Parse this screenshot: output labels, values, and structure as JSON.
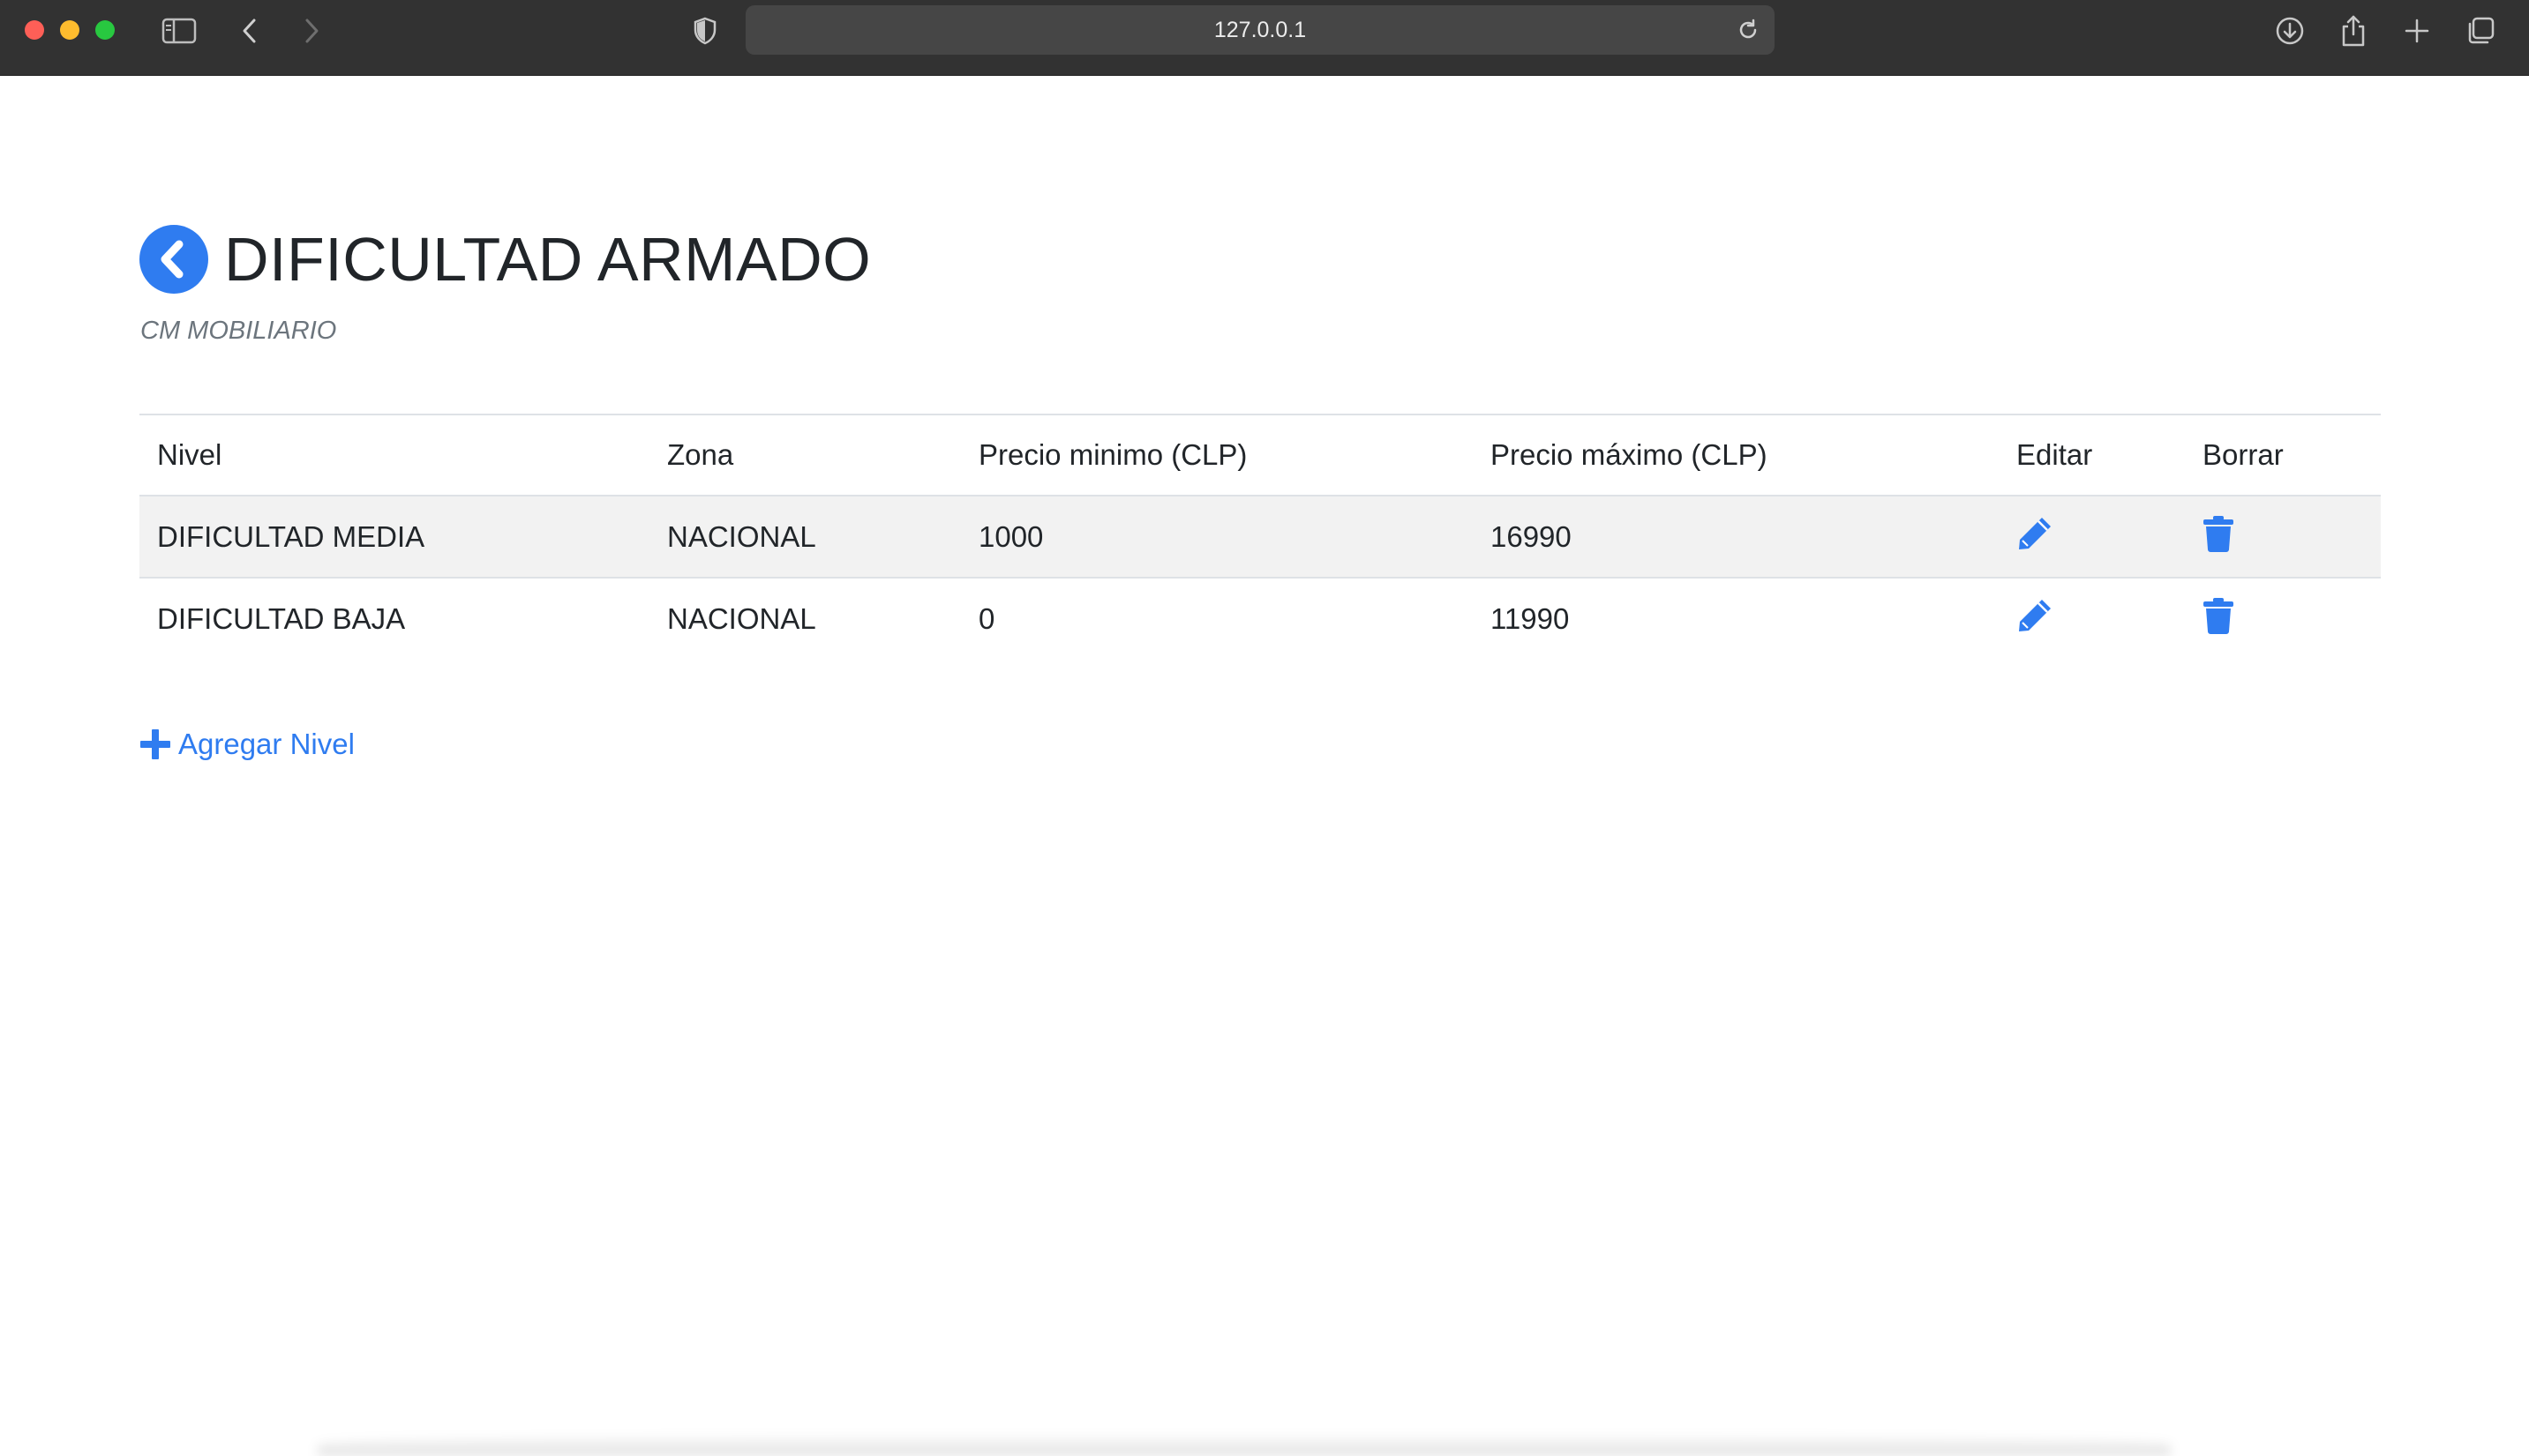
{
  "browser": {
    "url": "127.0.0.1"
  },
  "header": {
    "title": "DIFICULTAD ARMADO",
    "subtitle": "CM MOBILIARIO"
  },
  "table": {
    "columns": [
      "Nivel",
      "Zona",
      "Precio minimo (CLP)",
      "Precio máximo (CLP)",
      "Editar",
      "Borrar"
    ],
    "rows": [
      {
        "nivel": "DIFICULTAD MEDIA",
        "zona": "NACIONAL",
        "precio_min": "1000",
        "precio_max": "16990"
      },
      {
        "nivel": "DIFICULTAD BAJA",
        "zona": "NACIONAL",
        "precio_min": "0",
        "precio_max": "11990"
      }
    ]
  },
  "actions": {
    "add_label": "Agregar Nivel"
  },
  "icons": {
    "back": "chevron-left-icon",
    "edit": "pencil-icon",
    "delete": "trash-icon",
    "add": "plus-icon"
  },
  "colors": {
    "accent": "#2f7cf0",
    "text": "#212529",
    "muted": "#6c757d",
    "stripe": "#f2f2f2"
  }
}
